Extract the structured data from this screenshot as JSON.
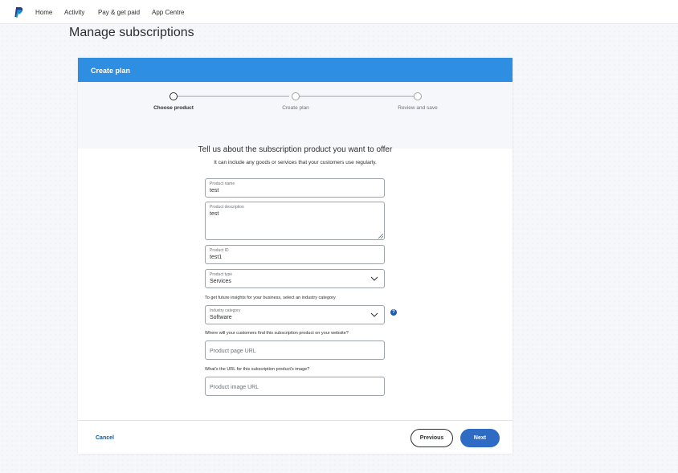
{
  "nav": {
    "links": [
      "Home",
      "Activity",
      "Pay & get paid",
      "App Centre"
    ]
  },
  "page": {
    "title": "Manage subscriptions"
  },
  "card": {
    "header": "Create plan",
    "steps": [
      {
        "label": "Choose product",
        "active": true
      },
      {
        "label": "Create plan",
        "active": false
      },
      {
        "label": "Review and save",
        "active": false
      }
    ]
  },
  "form": {
    "heading": "Tell us about the subscription product you want to offer",
    "subheading": "It can include any goods or services that your customers use regularly.",
    "product_name": {
      "label": "Product name",
      "value": "test"
    },
    "product_description": {
      "label": "Product description",
      "value": "test"
    },
    "product_id": {
      "label": "Product ID",
      "value": "test1"
    },
    "product_type": {
      "label": "Product type",
      "value": "Services"
    },
    "industry_helper": "To get future insights for your business, select an industry category",
    "industry_category": {
      "label": "Industry category",
      "value": "Software"
    },
    "page_url_helper": "Where will your customers find this subscription product on your website?",
    "page_url": {
      "placeholder": "Product page URL"
    },
    "image_url_helper": "What's the URL for this subscription product's image?",
    "image_url": {
      "placeholder": "Product image URL"
    }
  },
  "footer": {
    "cancel": "Cancel",
    "previous": "Previous",
    "next": "Next"
  },
  "colors": {
    "header_blue": "#2d8ee2",
    "primary_button": "#2d6bc4",
    "link": "#0c5a9e",
    "help_icon": "#1d5bb0"
  },
  "icons": [
    "paypal-logo-icon",
    "chevron-down-icon",
    "help-icon",
    "resize-handle-icon"
  ]
}
